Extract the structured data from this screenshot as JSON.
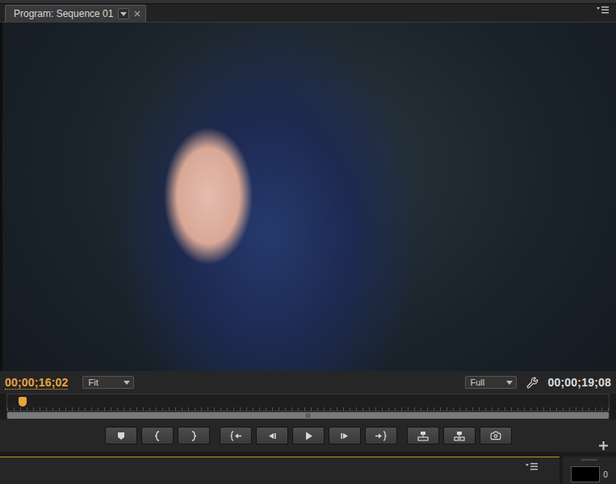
{
  "panel": {
    "title": "Program: Sequence 01"
  },
  "monitor": {
    "current_time": "00;00;16;02",
    "zoom": "Fit",
    "resolution": "Full",
    "duration": "00;00;19;08",
    "playhead": {
      "level": 0.025
    }
  },
  "transport": {
    "groups": [
      [
        {
          "kind": "marker"
        },
        {
          "kind": "markin"
        },
        {
          "kind": "markout"
        }
      ],
      [
        {
          "kind": "goin"
        },
        {
          "kind": "stepback"
        },
        {
          "kind": "play"
        },
        {
          "kind": "stepforward"
        },
        {
          "kind": "goout"
        }
      ],
      [
        {
          "kind": "lift"
        },
        {
          "kind": "extract"
        },
        {
          "kind": "export"
        }
      ]
    ]
  },
  "bottom_panel": {
    "meter_value": "0"
  }
}
